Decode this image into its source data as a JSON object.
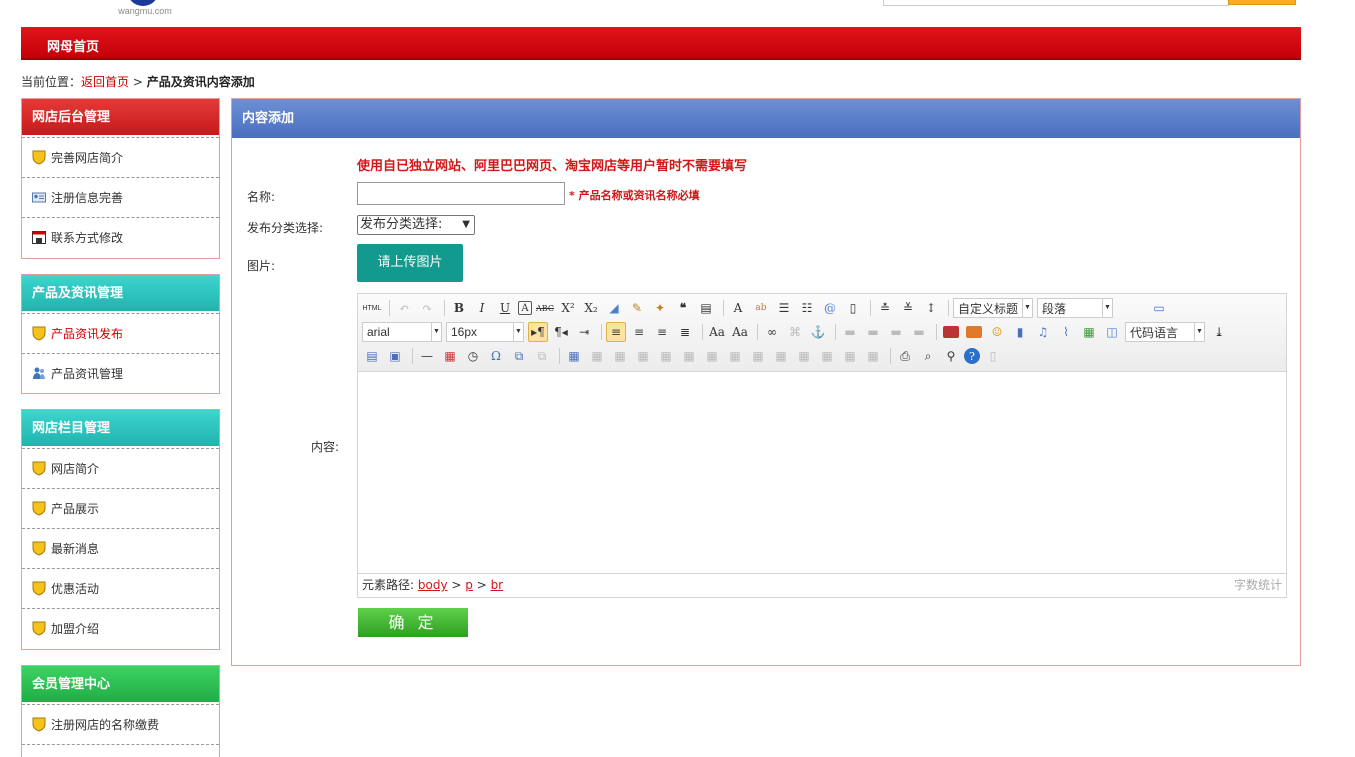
{
  "header": {
    "logo_text": "wangmu.com",
    "nav_home": "网母首页"
  },
  "breadcrumb": {
    "prefix": "当前位置：",
    "home_link": "返回首页",
    "separator": " > ",
    "current": "产品及资讯内容添加"
  },
  "sidebar": {
    "groups": [
      {
        "title": "网店后台管理",
        "color": "red",
        "items": [
          {
            "label": "完善网店简介",
            "icon": "shield-icon"
          },
          {
            "label": "注册信息完善",
            "icon": "id-card-icon"
          },
          {
            "label": "联系方式修改",
            "icon": "window-icon"
          }
        ]
      },
      {
        "title": "产品及资讯管理",
        "color": "teal",
        "items": [
          {
            "label": "产品资讯发布",
            "icon": "shield-icon",
            "active": true
          },
          {
            "label": "产品资讯管理",
            "icon": "users-icon"
          }
        ]
      },
      {
        "title": "网店栏目管理",
        "color": "teal",
        "items": [
          {
            "label": "网店简介",
            "icon": "shield-icon"
          },
          {
            "label": "产品展示",
            "icon": "shield-icon"
          },
          {
            "label": "最新消息",
            "icon": "shield-icon"
          },
          {
            "label": "优惠活动",
            "icon": "shield-icon"
          },
          {
            "label": "加盟介绍",
            "icon": "shield-icon"
          }
        ]
      },
      {
        "title": "会员管理中心",
        "color": "green",
        "items": [
          {
            "label": "注册网店的名称缴费",
            "icon": "shield-icon"
          }
        ]
      }
    ]
  },
  "panel": {
    "title": "内容添加",
    "notice": "使用自已独立网站、阿里巴巴网页、淘宝网店等用户暂时不需要填写",
    "name_label": "名称:",
    "name_value": "",
    "name_required": "* 产品名称或资讯名称必填",
    "category_label": "发布分类选择:",
    "category_selected": "发布分类选择:",
    "image_label": "图片:",
    "upload_button": "请上传图片",
    "content_label": "内容:",
    "submit_button": "确 定"
  },
  "editor": {
    "heading_select": "自定义标题",
    "paragraph_select": "段落",
    "font_select": "arial",
    "size_select": "16px",
    "code_select": "代码语言",
    "html_button": "HTML",
    "path_label": "元素路径:",
    "path_items": [
      "body",
      "p",
      "br"
    ],
    "word_count": "字数统计"
  },
  "colors": {
    "nav_red": "#d40a10",
    "panel_blue": "#5a7ec9",
    "notice_red": "#d01818",
    "upload_teal": "#119a8d",
    "submit_green": "#3db82e"
  }
}
